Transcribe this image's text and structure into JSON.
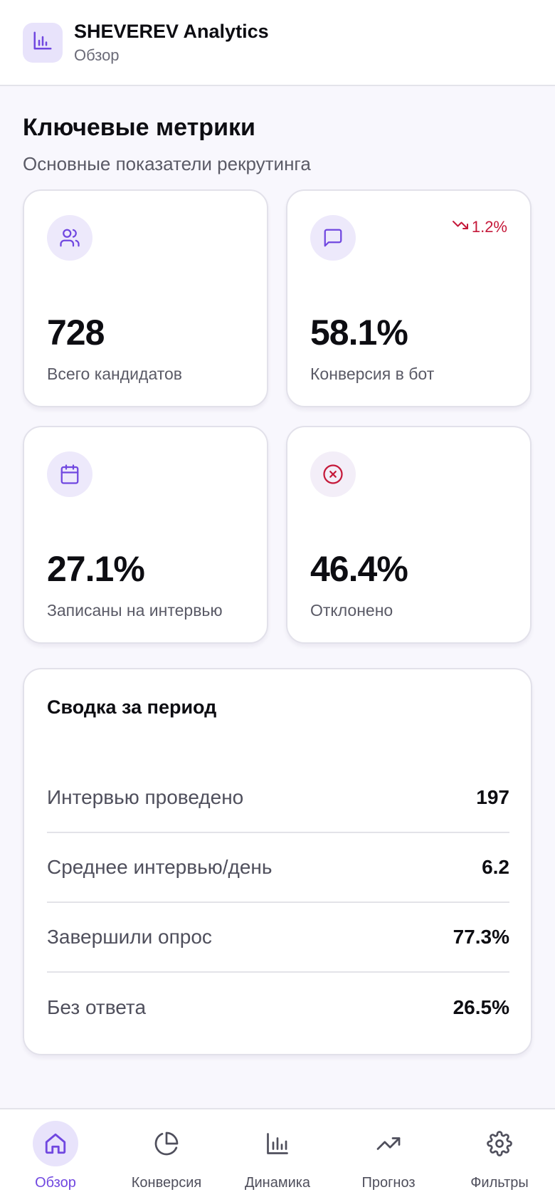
{
  "header": {
    "title": "SHEVEREV Analytics",
    "subtitle": "Обзор",
    "logo_icon": "bar-chart-icon"
  },
  "overview": {
    "title": "Ключевые метрики",
    "subtitle": "Основные показатели рекрутинга"
  },
  "metrics": [
    {
      "icon": "users-icon",
      "value": "728",
      "label": "Всего кандидатов"
    },
    {
      "icon": "message-square-icon",
      "value": "58.1%",
      "label": "Конверсия в бот",
      "trend": {
        "direction": "down",
        "value": "1.2%"
      }
    },
    {
      "icon": "calendar-icon",
      "value": "27.1%",
      "label": "Записаны на интервью"
    },
    {
      "icon": "x-circle-icon",
      "value": "46.4%",
      "label": "Отклонено"
    }
  ],
  "summary": {
    "title": "Сводка за период",
    "rows": [
      {
        "label": "Интервью проведено",
        "value": "197"
      },
      {
        "label": "Среднее интервью/день",
        "value": "6.2"
      },
      {
        "label": "Завершили опрос",
        "value": "77.3%"
      },
      {
        "label": "Без ответа",
        "value": "26.5%"
      }
    ]
  },
  "nav": {
    "items": [
      {
        "label": "Обзор",
        "icon": "home-icon",
        "active": true
      },
      {
        "label": "Конверсия",
        "icon": "pie-chart-icon",
        "active": false
      },
      {
        "label": "Динамика",
        "icon": "bar-chart-icon",
        "active": false
      },
      {
        "label": "Прогноз",
        "icon": "trending-up-icon",
        "active": false
      },
      {
        "label": "Фильтры",
        "icon": "settings-icon",
        "active": false
      }
    ]
  },
  "colors": {
    "accent": "#7047e0",
    "accent_soft": "#e8e3fb",
    "danger": "#c5193a",
    "background": "#f8f7fd"
  }
}
